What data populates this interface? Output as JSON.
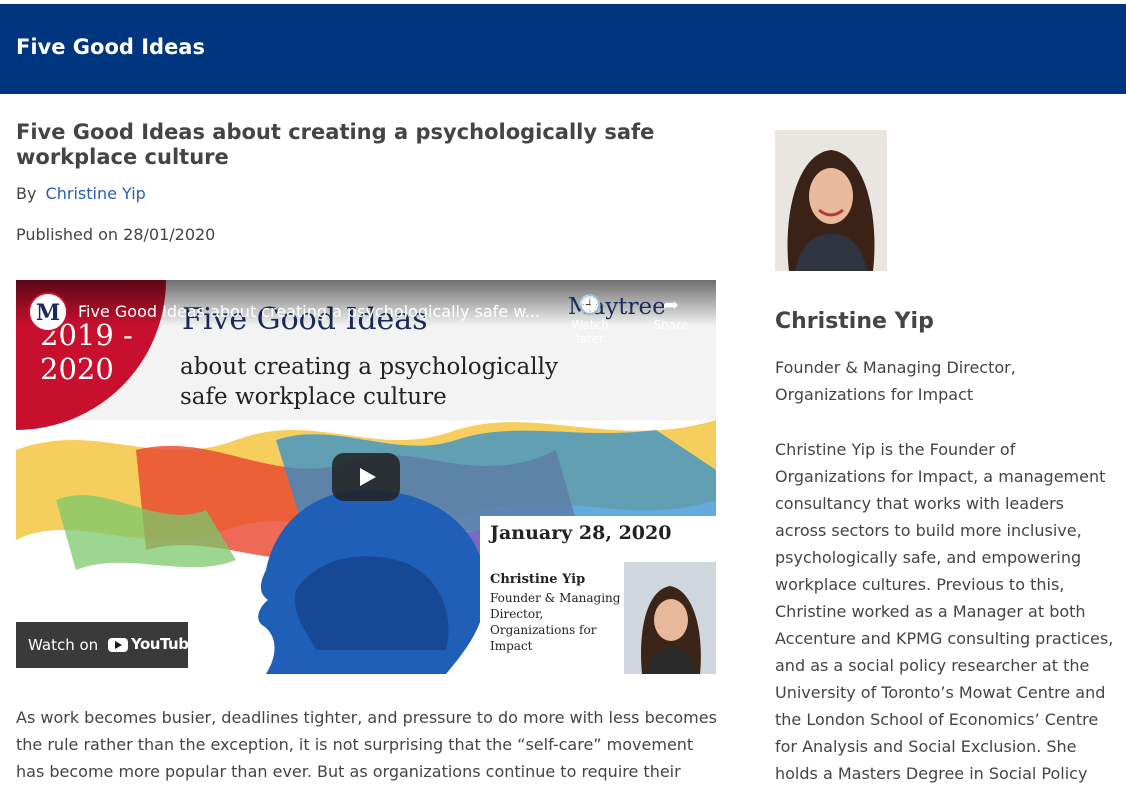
{
  "site": {
    "title": "Five Good Ideas"
  },
  "article": {
    "title": "Five Good Ideas about creating a psychologically safe workplace culture",
    "by_label": "By",
    "author": "Christine Yip",
    "published": "Published on 28/01/2020",
    "intro": "As work becomes busier, deadlines tighter, and pressure to do more with less becomes the rule rather than the exception, it is not surprising that the “self-care” movement has become more popular than ever. But as organizations continue to require their people to deliver more"
  },
  "video": {
    "title": "Five Good Ideas about creating a psychologically safe w...",
    "channel_logo_letter": "M",
    "year": "2019 -\n2020",
    "slide_title": "Five Good Ideas",
    "slide_subtitle": "about creating a psychologically safe workplace culture",
    "brand": "Maytree",
    "watch_later": "Watch later",
    "share": "Share",
    "event_date": "January 28, 2020",
    "speaker_name": "Christine Yip",
    "speaker_role": "Founder & Managing Director, Organizations for Impact",
    "watch_on": "Watch on",
    "youtube": "YouTube"
  },
  "author_card": {
    "name": "Christine Yip",
    "role": "Founder & Managing Director, Organizations for Impact",
    "bio": "Christine Yip is the Founder of Organizations for Impact, a management consultancy that works with leaders across sectors to build more inclusive, psychologically safe, and empowering workplace cultures. Previous to this, Christine worked as a Manager at both Accenture and KPMG consulting practices, and as a social policy researcher at the University of Toronto’s Mowat Centre and the London School of Economics’ Centre for Analysis and Social Exclusion. She holds a Masters Degree in Social Policy"
  },
  "colors": {
    "header": "#003580",
    "link": "#2a5db0",
    "accent_red": "#c8102e"
  }
}
